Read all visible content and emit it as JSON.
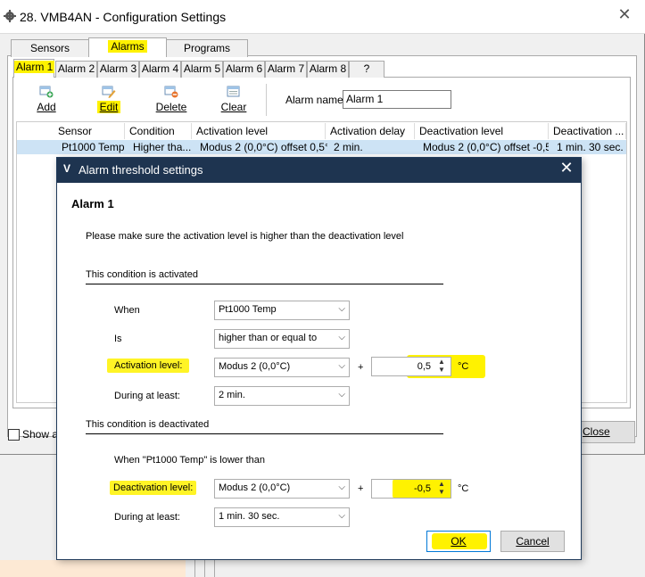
{
  "main_window": {
    "title": "28. VMB4AN - Configuration Settings",
    "tabs": [
      "Sensors",
      "Alarms",
      "Programs"
    ],
    "active_tab": "Alarms",
    "alarm_tabs": [
      "Alarm 1",
      "Alarm 2",
      "Alarm 3",
      "Alarm 4",
      "Alarm 5",
      "Alarm 6",
      "Alarm 7",
      "Alarm 8",
      "?"
    ],
    "toolbar": {
      "add": "Add",
      "edit": "Edit",
      "delete": "Delete",
      "clear": "Clear"
    },
    "alarm_name_label": "Alarm name:",
    "alarm_name_value": "Alarm 1",
    "grid": {
      "columns": [
        "Sensor",
        "Condition",
        "Activation level",
        "Activation delay",
        "Deactivation level",
        "Deactivation ..."
      ],
      "row": [
        "Pt1000 Temp",
        "Higher tha...",
        "Modus 2 (0,0°C) offset 0,5°C",
        "2 min.",
        "Modus 2 (0,0°C) offset -0,5...",
        "1 min. 30 sec."
      ]
    },
    "show_all_label": "Show a",
    "close_label": "Close"
  },
  "dialog": {
    "title": "Alarm threshold settings",
    "logo": "V",
    "heading": "Alarm 1",
    "instruction": "Please make sure the activation level is higher than the deactivation level",
    "activated": {
      "header": "This condition is activated",
      "when_label": "When",
      "when_value": "Pt1000 Temp",
      "is_label": "Is",
      "is_value": "higher than or equal to",
      "level_label": "Activation level:",
      "level_value": "Modus 2 (0,0°C)",
      "plus": "+",
      "offset": "0,5",
      "unit": "°C",
      "during_label": "During at least:",
      "during_value": "2 min."
    },
    "deactivated": {
      "header": "This condition is deactivated",
      "when_text": "When \"Pt1000 Temp\" is lower than",
      "level_label": "Deactivation level:",
      "level_value": "Modus 2 (0,0°C)",
      "plus": "+",
      "offset": "-0,5",
      "unit": "°C",
      "during_label": "During at least:",
      "during_value": "1 min. 30 sec."
    },
    "ok_label": "OK",
    "cancel_label": "Cancel"
  },
  "colors": {
    "dialog_titlebar": "#1e3450",
    "highlight": "#fff200",
    "selected_row": "#cde3f5"
  }
}
